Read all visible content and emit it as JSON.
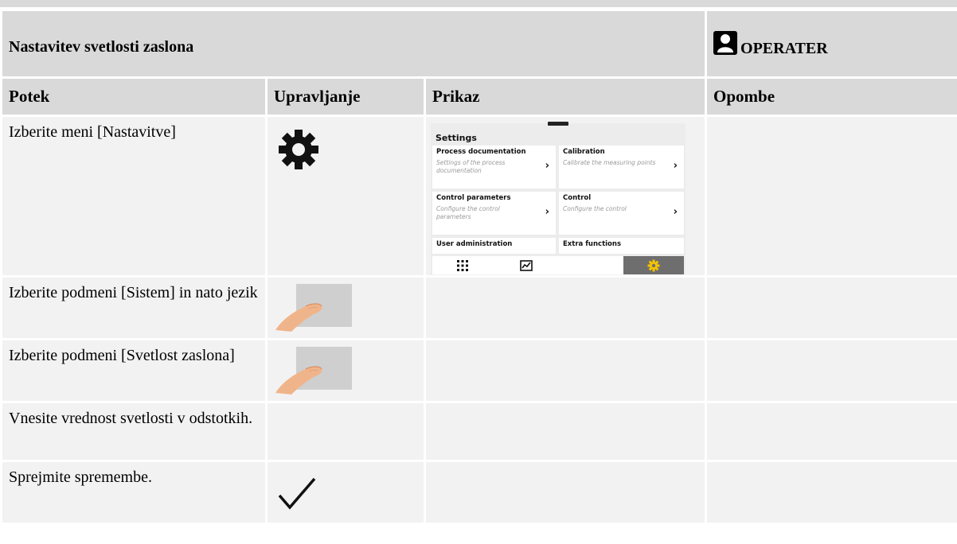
{
  "title": "Nastavitev svetlosti zaslona",
  "role": {
    "label": "OPERATER",
    "icon": "operator-person-icon"
  },
  "columns": [
    "Potek",
    "Upravljanje",
    "Prikaz",
    "Opombe"
  ],
  "steps": [
    {
      "text": "Izberite meni [Nastavitve]",
      "control_icon": "gear-icon"
    },
    {
      "text": "Izberite podmeni [Sistem] in nato jezik",
      "control_icon": "finger-touch-icon"
    },
    {
      "text": "Izberite podmeni [Svetlost zaslona]",
      "control_icon": "finger-touch-icon"
    },
    {
      "text": "Vnesite vrednost svetlosti v odstotkih.",
      "control_icon": ""
    },
    {
      "text": "Sprejmite spremembe.",
      "control_icon": "checkmark-icon"
    }
  ],
  "device_screen": {
    "title": "Settings",
    "tiles": [
      {
        "name": "Process documentation",
        "desc": "Settings of the process documentation"
      },
      {
        "name": "Calibration",
        "desc": "Calibrate the measuring points"
      },
      {
        "name": "Control parameters",
        "desc": "Configure the control parameters"
      },
      {
        "name": "Control",
        "desc": "Configure the control"
      },
      {
        "name": "User administration",
        "desc": ""
      },
      {
        "name": "Extra functions",
        "desc": ""
      }
    ],
    "nav_icons": [
      "grid-icon",
      "chart-icon",
      "settings-gear-icon"
    ],
    "active_nav_color": "#6e6e6e",
    "active_icon_color": "#f5c400"
  },
  "colors": {
    "header_bg": "#d9d9d9",
    "cell_bg": "#f2f2f2"
  }
}
